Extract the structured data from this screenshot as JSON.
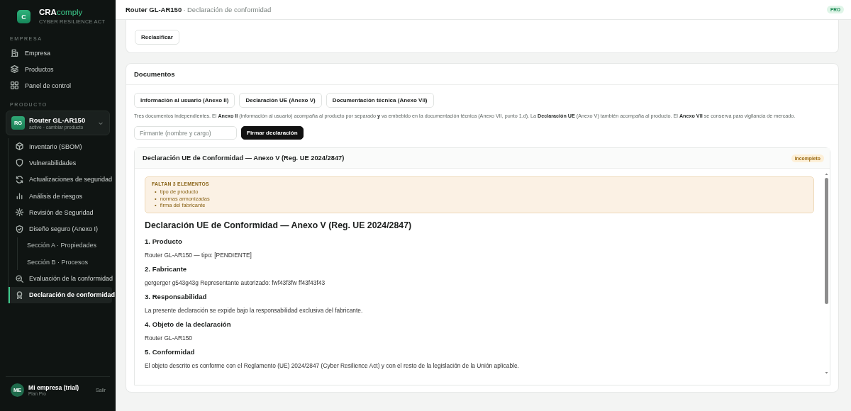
{
  "brand": {
    "logo_letter": "C",
    "name_bold": "CRA",
    "name_light": "comply",
    "tagline": "CYBER RESILIENCE ACT"
  },
  "sidebar": {
    "company_heading": "EMPRESA",
    "company_items": [
      {
        "label": "Empresa",
        "selected": false
      },
      {
        "label": "Productos",
        "selected": false
      },
      {
        "label": "Panel de control",
        "selected": false
      }
    ],
    "product_heading": "PRODUCTO",
    "product": {
      "initials": "RG",
      "name": "Router GL-AR150",
      "subtitle": "active · cambiar producto"
    },
    "product_items": [
      {
        "label": "Inventario (SBOM)",
        "selected": false
      },
      {
        "label": "Vulnerabilidades",
        "selected": false
      },
      {
        "label": "Actualizaciones de seguridad",
        "selected": false
      },
      {
        "label": "Análisis de riesgos",
        "selected": false
      },
      {
        "label": "Revisión de Seguridad",
        "selected": false
      },
      {
        "label": "Diseño seguro (Anexo I)",
        "selected": false,
        "children": [
          {
            "label": "Sección A · Propiedades",
            "selected": false
          },
          {
            "label": "Sección B · Procesos",
            "selected": false
          }
        ]
      },
      {
        "label": "Evaluación de la conformidad",
        "selected": false
      },
      {
        "label": "Declaración de conformidad",
        "selected": true
      }
    ],
    "account": {
      "initials": "ME",
      "name": "Mi empresa (trial)",
      "plan": "Plan Pro",
      "logout": "Salir"
    }
  },
  "header": {
    "product": "Router GL-AR150",
    "separator": "·",
    "page": "Declaración de conformidad",
    "badge": "PRO"
  },
  "classification_card": {
    "button": "Reclasificar"
  },
  "documents": {
    "title": "Documentos",
    "tabs": [
      "Información al usuario (Anexo II)",
      "Declaración UE (Anexo V)",
      "Documentación técnica (Anexo VII)"
    ],
    "description": "Tres documentos independientes. El **Anexo II** (información al usuario) acompaña al producto por separado **y** va embebido en la documentación técnica (Anexo VII, punto 1.d). La **Declaración UE** (Anexo V) también acompaña al producto. El **Anexo VII** se conserva para vigilancia de mercado.",
    "signer": {
      "placeholder": "Firmante (nombre y cargo)"
    },
    "sign_button": "Firmar declaración",
    "declaration": {
      "title": "Declaración UE de Conformidad — Anexo V (Reg. UE 2024/2847)",
      "status": "Incompleto",
      "missing": {
        "heading": "FALTAN 3 ELEMENTOS",
        "bullet": "•",
        "items": [
          "tipo de producto",
          "normas armonizadas",
          "firma del fabricante"
        ]
      },
      "doc_title": "Declaración UE de Conformidad — Anexo V (Reg. UE 2024/2847)",
      "sections": [
        {
          "heading": "1. Producto",
          "text": "Router GL-AR150 — tipo: [PENDIENTE]"
        },
        {
          "heading": "2. Fabricante",
          "text": "gergerger g543g43g Representante autorizado: fwf43f3fw ff43f43f43"
        },
        {
          "heading": "3. Responsabilidad",
          "text": "La presente declaración se expide bajo la responsabilidad exclusiva del fabricante."
        },
        {
          "heading": "4. Objeto de la declaración",
          "text": "Router GL-AR150"
        },
        {
          "heading": "5. Conformidad",
          "text": "El objeto descrito es conforme con el Reglamento (UE) 2024/2847 (Cyber Resilience Act) y con el resto de la legislación de la Unión aplicable."
        }
      ]
    }
  }
}
